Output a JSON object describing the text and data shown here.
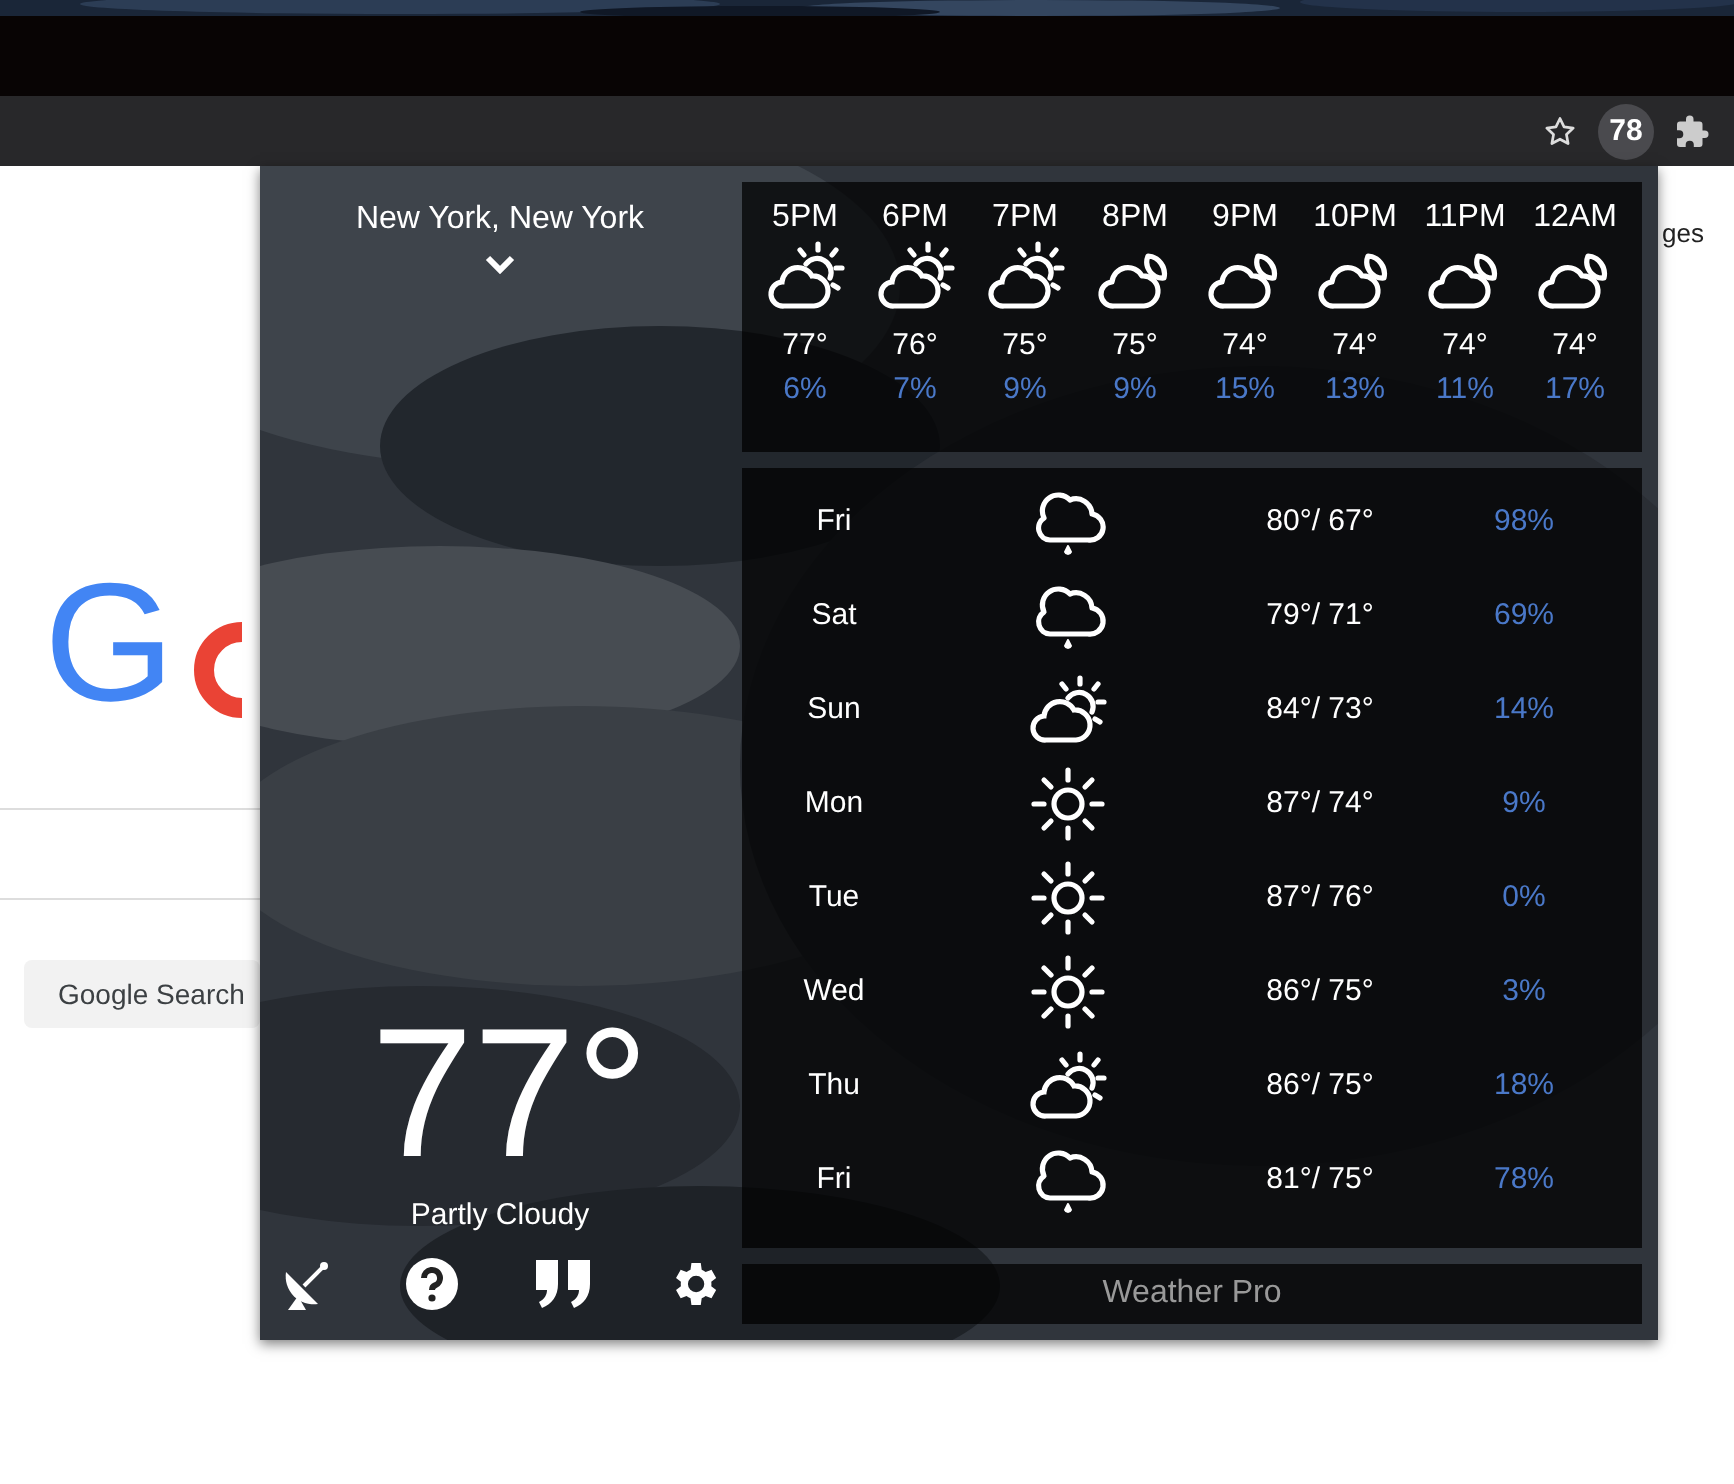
{
  "browser": {
    "extension_badge": "78"
  },
  "page": {
    "logo": {
      "letter": "G",
      "color": "#4285f4"
    },
    "search_button": "Google Search",
    "link_fragment": "ges"
  },
  "weather": {
    "location": "New York, New York",
    "current": {
      "temperature": "77°",
      "condition": "Partly Cloudy"
    },
    "hourly": [
      {
        "time": "5PM",
        "kind": "partly-sunny",
        "temp": "77°",
        "precip": "6%"
      },
      {
        "time": "6PM",
        "kind": "partly-sunny",
        "temp": "76°",
        "precip": "7%"
      },
      {
        "time": "7PM",
        "kind": "partly-sunny",
        "temp": "75°",
        "precip": "9%"
      },
      {
        "time": "8PM",
        "kind": "cloudy-night",
        "temp": "75°",
        "precip": "9%"
      },
      {
        "time": "9PM",
        "kind": "cloudy-night",
        "temp": "74°",
        "precip": "15%"
      },
      {
        "time": "10PM",
        "kind": "cloudy-night",
        "temp": "74°",
        "precip": "13%"
      },
      {
        "time": "11PM",
        "kind": "cloudy-night",
        "temp": "74°",
        "precip": "11%"
      },
      {
        "time": "12AM",
        "kind": "cloudy-night",
        "temp": "74°",
        "precip": "17%"
      }
    ],
    "daily": [
      {
        "day": "Fri",
        "kind": "rain",
        "temps": "80°/ 67°",
        "precip": "98%"
      },
      {
        "day": "Sat",
        "kind": "rain",
        "temps": "79°/ 71°",
        "precip": "69%"
      },
      {
        "day": "Sun",
        "kind": "partly-sunny",
        "temps": "84°/ 73°",
        "precip": "14%"
      },
      {
        "day": "Mon",
        "kind": "sunny",
        "temps": "87°/ 74°",
        "precip": "9%"
      },
      {
        "day": "Tue",
        "kind": "sunny",
        "temps": "87°/ 76°",
        "precip": "0%"
      },
      {
        "day": "Wed",
        "kind": "sunny",
        "temps": "86°/ 75°",
        "precip": "3%"
      },
      {
        "day": "Thu",
        "kind": "partly-sunny",
        "temps": "86°/ 75°",
        "precip": "18%"
      },
      {
        "day": "Fri",
        "kind": "rain",
        "temps": "81°/ 75°",
        "precip": "78%"
      }
    ],
    "footer": "Weather Pro"
  }
}
